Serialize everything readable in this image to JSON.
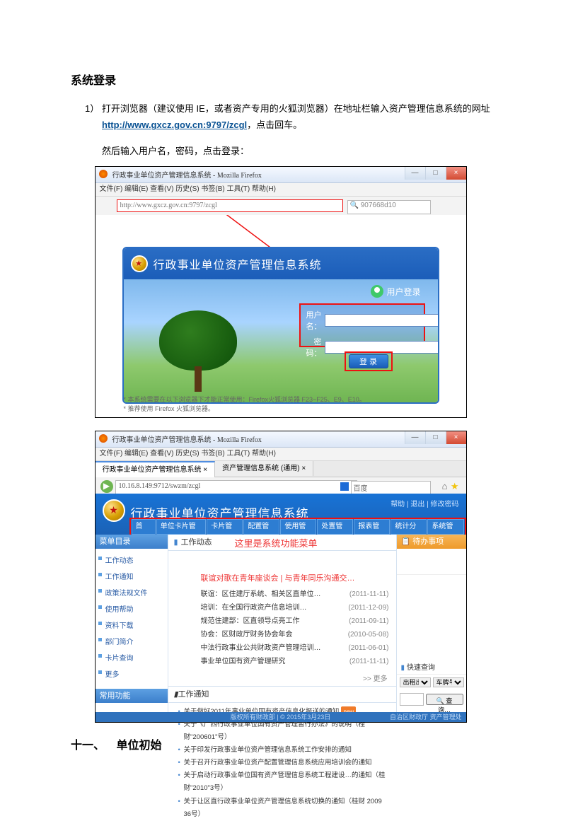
{
  "heading1": "系统登录",
  "step1_a": "1） 打开浏览器（建议使用 IE，或者资产专用的火狐浏览器）在地址栏输入资产管理信息系统的网址 ",
  "step1_url": "http://www.gxcz.gov.cn:9797/zcgl",
  "step1_b": "，点击回车。",
  "step1_c": "然后输入用户名，密码，点击",
  "step1_login": "登录",
  "step1_d": "：",
  "shot1": {
    "title": "行政事业单位资产管理信息系统 - Mozilla Firefox",
    "menu": "文件(F)  编辑(E)  查看(V)  历史(S)  书签(B)  工具(T)  帮助(H)",
    "addr": "http://www.gxcz.gov.cn:9797/zcgl",
    "search": "907668d10",
    "banner": "行政事业单位资产管理信息系统",
    "userpane": "用户登录",
    "user_lb": "用户名：",
    "pwd_lb": "密  码：",
    "login_btn": "登 录",
    "foot1": "* 本系统需要在以下浏览器下才能正常使用：Firefox火狐浏览器 F23~F25、E9、E10。",
    "foot2": "* 推荐使用 Firefox 火狐浏览器。"
  },
  "shot2": {
    "title": "行政事业单位资产管理信息系统 - Mozilla Firefox",
    "menu": "文件(F)  编辑(E)  查看(V)  历史(S)  书签(B)  工具(T)  帮助(H)",
    "tab1": "行政事业单位资产管理信息系统  ×",
    "tab2": "资产管理信息系统 (通用)  ×",
    "addr": "10.16.8.149:9712/swzm/zcgl",
    "search": "百度",
    "banner": "行政事业单位资产管理信息系统",
    "blinks": "帮助 | 退出 | 修改密码",
    "menus": [
      "首 页",
      "单位卡片管理",
      "卡片管理",
      "配置管理",
      "使用管理",
      "处置管理",
      "报表管理",
      "统计分析",
      "系统管理"
    ],
    "side_head": "菜单目录",
    "side_items": [
      "工作动态",
      "工作通知",
      "政策法规文件",
      "使用帮助",
      "资料下载",
      "部门简介",
      "卡片查询",
      "更多"
    ],
    "side_head2": "常用功能",
    "pane1": "工作动态",
    "red_note": "这里是系统功能菜单",
    "news_top": "联谊对歌在青年座谈会 | 与青年同乐沟通交…",
    "news": [
      [
        "联谊：区住建厅系统、相关区直单位…",
        "(2011-11-11)"
      ],
      [
        "培训：在全国行政资产信息培训…",
        "(2011-12-09)"
      ],
      [
        "规范住建部：区直领导点亮工作",
        "(2011-09-11)"
      ],
      [
        "协会：区财政厅财务协会年会",
        "(2010-05-08)"
      ],
      [
        "中法行政事业公共财政资产管理培训…",
        "(2011-06-01)"
      ],
      [
        "事业单位国有资产管理研究",
        "(2011-11-11)"
      ]
    ],
    "more": ">> 更多",
    "pane2": "工作通知",
    "notice": [
      "关于做好2011年事业单位国有资产信息化报送的通知",
      "关于《广西行政事业单位国有资产管理暂行办法》的说明（桂财\"200601\"号）",
      "关于印发行政事业单位资产管理信息系统工作安排的通知",
      "关于召开行政事业单位资产配置管理信息系统应用培训会的通知",
      "关于启动行政事业单位国有资产管理信息系统工程建设…的通知（桂财\"2010\"3号）",
      "关于让区直行政事业单位资产管理信息系统切换的通知（桂财 2009 36号）"
    ],
    "rhead": "待办事项",
    "rhead2": "快速查询",
    "footer": "版权所有财政部 | © 2015年3月23日",
    "footer_r": "自治区财政厅  资产管理处"
  },
  "h11_num": "十一、",
  "h11_txt": "单位初始"
}
